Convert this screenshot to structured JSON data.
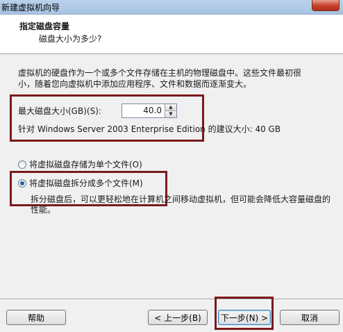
{
  "window": {
    "title": "新建虚拟机向导"
  },
  "header": {
    "title": "指定磁盘容量",
    "subtitle": "磁盘大小为多少?"
  },
  "description": {
    "line1": "虚拟机的硬盘作为一个或多个文件存储在主机的物理磁盘中。这些文件最初很",
    "line2": "小，随着您向虚拟机中添加应用程序、文件和数据而逐渐变大。"
  },
  "disk_size": {
    "label": "最大磁盘大小(GB)(S):",
    "value": "40.0",
    "recommend": "针对 Windows Server 2003 Enterprise Edition 的建议大小: 40 GB"
  },
  "storage_options": {
    "single_file": {
      "label": "将虚拟磁盘存储为单个文件(O)",
      "selected": false
    },
    "split_files": {
      "label": "将虚拟磁盘拆分成多个文件(M)",
      "selected": true,
      "desc_line1": "拆分磁盘后，可以更轻松地在计算机之间移动虚拟机，但可能会降低大容量磁盘的",
      "desc_line2": "性能。"
    }
  },
  "buttons": {
    "help": "帮助",
    "back": "< 上一步(B)",
    "next": "下一步(N) >",
    "cancel": "取消"
  },
  "colors": {
    "highlight_border": "#7a1a1a",
    "title_bar": "#b9d1ea"
  }
}
